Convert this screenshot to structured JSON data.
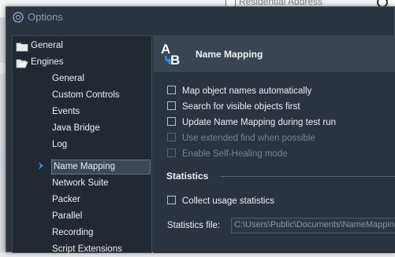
{
  "background": {
    "checkbox_label": "Residential Address"
  },
  "dialog": {
    "title": "Options"
  },
  "tree": {
    "items": [
      {
        "label": "General",
        "level": 0,
        "icon": "folder-closed-icon"
      },
      {
        "label": "Engines",
        "level": 0,
        "icon": "folder-open-icon"
      },
      {
        "label": "General",
        "level": 1
      },
      {
        "label": "Custom Controls",
        "level": 1
      },
      {
        "label": "Events",
        "level": 1
      },
      {
        "label": "Java Bridge",
        "level": 1
      },
      {
        "label": "Log",
        "level": 1
      },
      {
        "label": "Name Mapping",
        "level": 1,
        "selected": true
      },
      {
        "label": "Network Suite",
        "level": 1
      },
      {
        "label": "Packer",
        "level": 1
      },
      {
        "label": "Parallel",
        "level": 1
      },
      {
        "label": "Recording",
        "level": 1
      },
      {
        "label": "Script Extensions",
        "level": 1
      }
    ]
  },
  "panel": {
    "title": "Name Mapping",
    "icon": "name-mapping-icon",
    "options": [
      {
        "label": "Map object names automatically",
        "checked": false,
        "enabled": true
      },
      {
        "label": "Search for visible objects first",
        "checked": false,
        "enabled": true
      },
      {
        "label": "Update Name Mapping during test run",
        "checked": false,
        "enabled": true
      },
      {
        "label": "Use extended find when possible",
        "checked": false,
        "enabled": false
      },
      {
        "label": "Enable Self-Healing mode",
        "checked": false,
        "enabled": false
      }
    ],
    "statistics": {
      "title": "Statistics",
      "collect_label": "Collect usage statistics",
      "collect_checked": false,
      "file_label": "Statistics file:",
      "file_value": "C:\\Users\\Public\\Documents\\NameMappingUsage"
    }
  },
  "colors": {
    "dialog_bg": "#2b3340",
    "tree_bg": "#222933",
    "header_bg": "#3a4452",
    "selection_arrow": "#2f8fe0",
    "text": "#eef0f3",
    "disabled_text": "#7a8493"
  }
}
